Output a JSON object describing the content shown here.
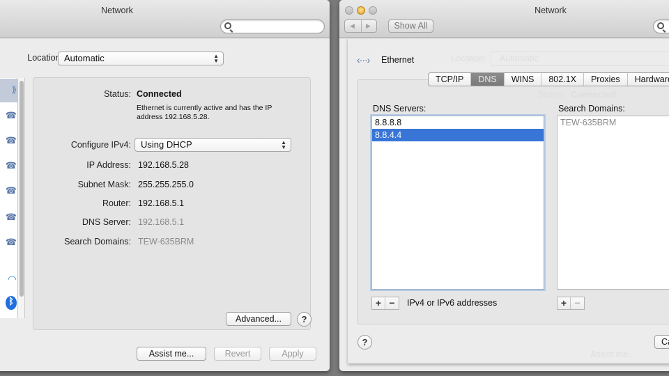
{
  "left_window": {
    "title": "Network",
    "search": {
      "placeholder": "",
      "value": ""
    },
    "location": {
      "label": "Location:",
      "value": "Automatic"
    },
    "services": [
      {
        "icon": "ethernet-icon",
        "selected": true
      },
      {
        "icon": "phone-modem-icon",
        "selected": false
      },
      {
        "icon": "phone-modem-icon",
        "selected": false
      },
      {
        "icon": "phone-modem-icon",
        "selected": false
      },
      {
        "icon": "phone-modem-icon",
        "selected": false
      },
      {
        "icon": "phone-modem-icon",
        "selected": false
      },
      {
        "icon": "phone-modem-icon",
        "selected": false
      },
      {
        "icon": "wifi-icon",
        "selected": false
      },
      {
        "icon": "bluetooth-icon",
        "selected": false
      }
    ],
    "details": {
      "status_label": "Status:",
      "status_value": "Connected",
      "status_desc_line1": "Ethernet is currently active and has the IP",
      "status_desc_line2": "address 192.168.5.28.",
      "configure_label": "Configure IPv4:",
      "configure_value": "Using DHCP",
      "ip_label": "IP Address:",
      "ip_value": "192.168.5.28",
      "subnet_label": "Subnet Mask:",
      "subnet_value": "255.255.255.0",
      "router_label": "Router:",
      "router_value": "192.168.5.1",
      "dns_label": "DNS Server:",
      "dns_value": "192.168.5.1",
      "search_label": "Search Domains:",
      "search_value": "TEW-635BRM"
    },
    "buttons": {
      "advanced": "Advanced...",
      "help": "?",
      "assist": "Assist me...",
      "revert": "Revert",
      "apply": "Apply"
    }
  },
  "right_window": {
    "title": "Network",
    "show_all": "Show All",
    "service_name": "Ethernet",
    "ghost": {
      "location_label": "Location:",
      "location_value": "Automatic",
      "status_label": "Status:",
      "status_value": "Connected",
      "assist": "Assist me..."
    },
    "tabs": [
      {
        "label": "TCP/IP",
        "active": false
      },
      {
        "label": "DNS",
        "active": true
      },
      {
        "label": "WINS",
        "active": false
      },
      {
        "label": "802.1X",
        "active": false
      },
      {
        "label": "Proxies",
        "active": false
      },
      {
        "label": "Hardware",
        "active": false
      }
    ],
    "dns_servers": {
      "label": "DNS Servers:",
      "items": [
        "8.8.8.8",
        "8.8.4.4"
      ],
      "selected_index": 1,
      "hint": "IPv4 or IPv6 addresses"
    },
    "search_domains": {
      "label": "Search Domains:",
      "items": [
        "TEW-635BRM"
      ]
    },
    "plus": "+",
    "minus": "−",
    "help": "?",
    "cancel": "Ca"
  }
}
